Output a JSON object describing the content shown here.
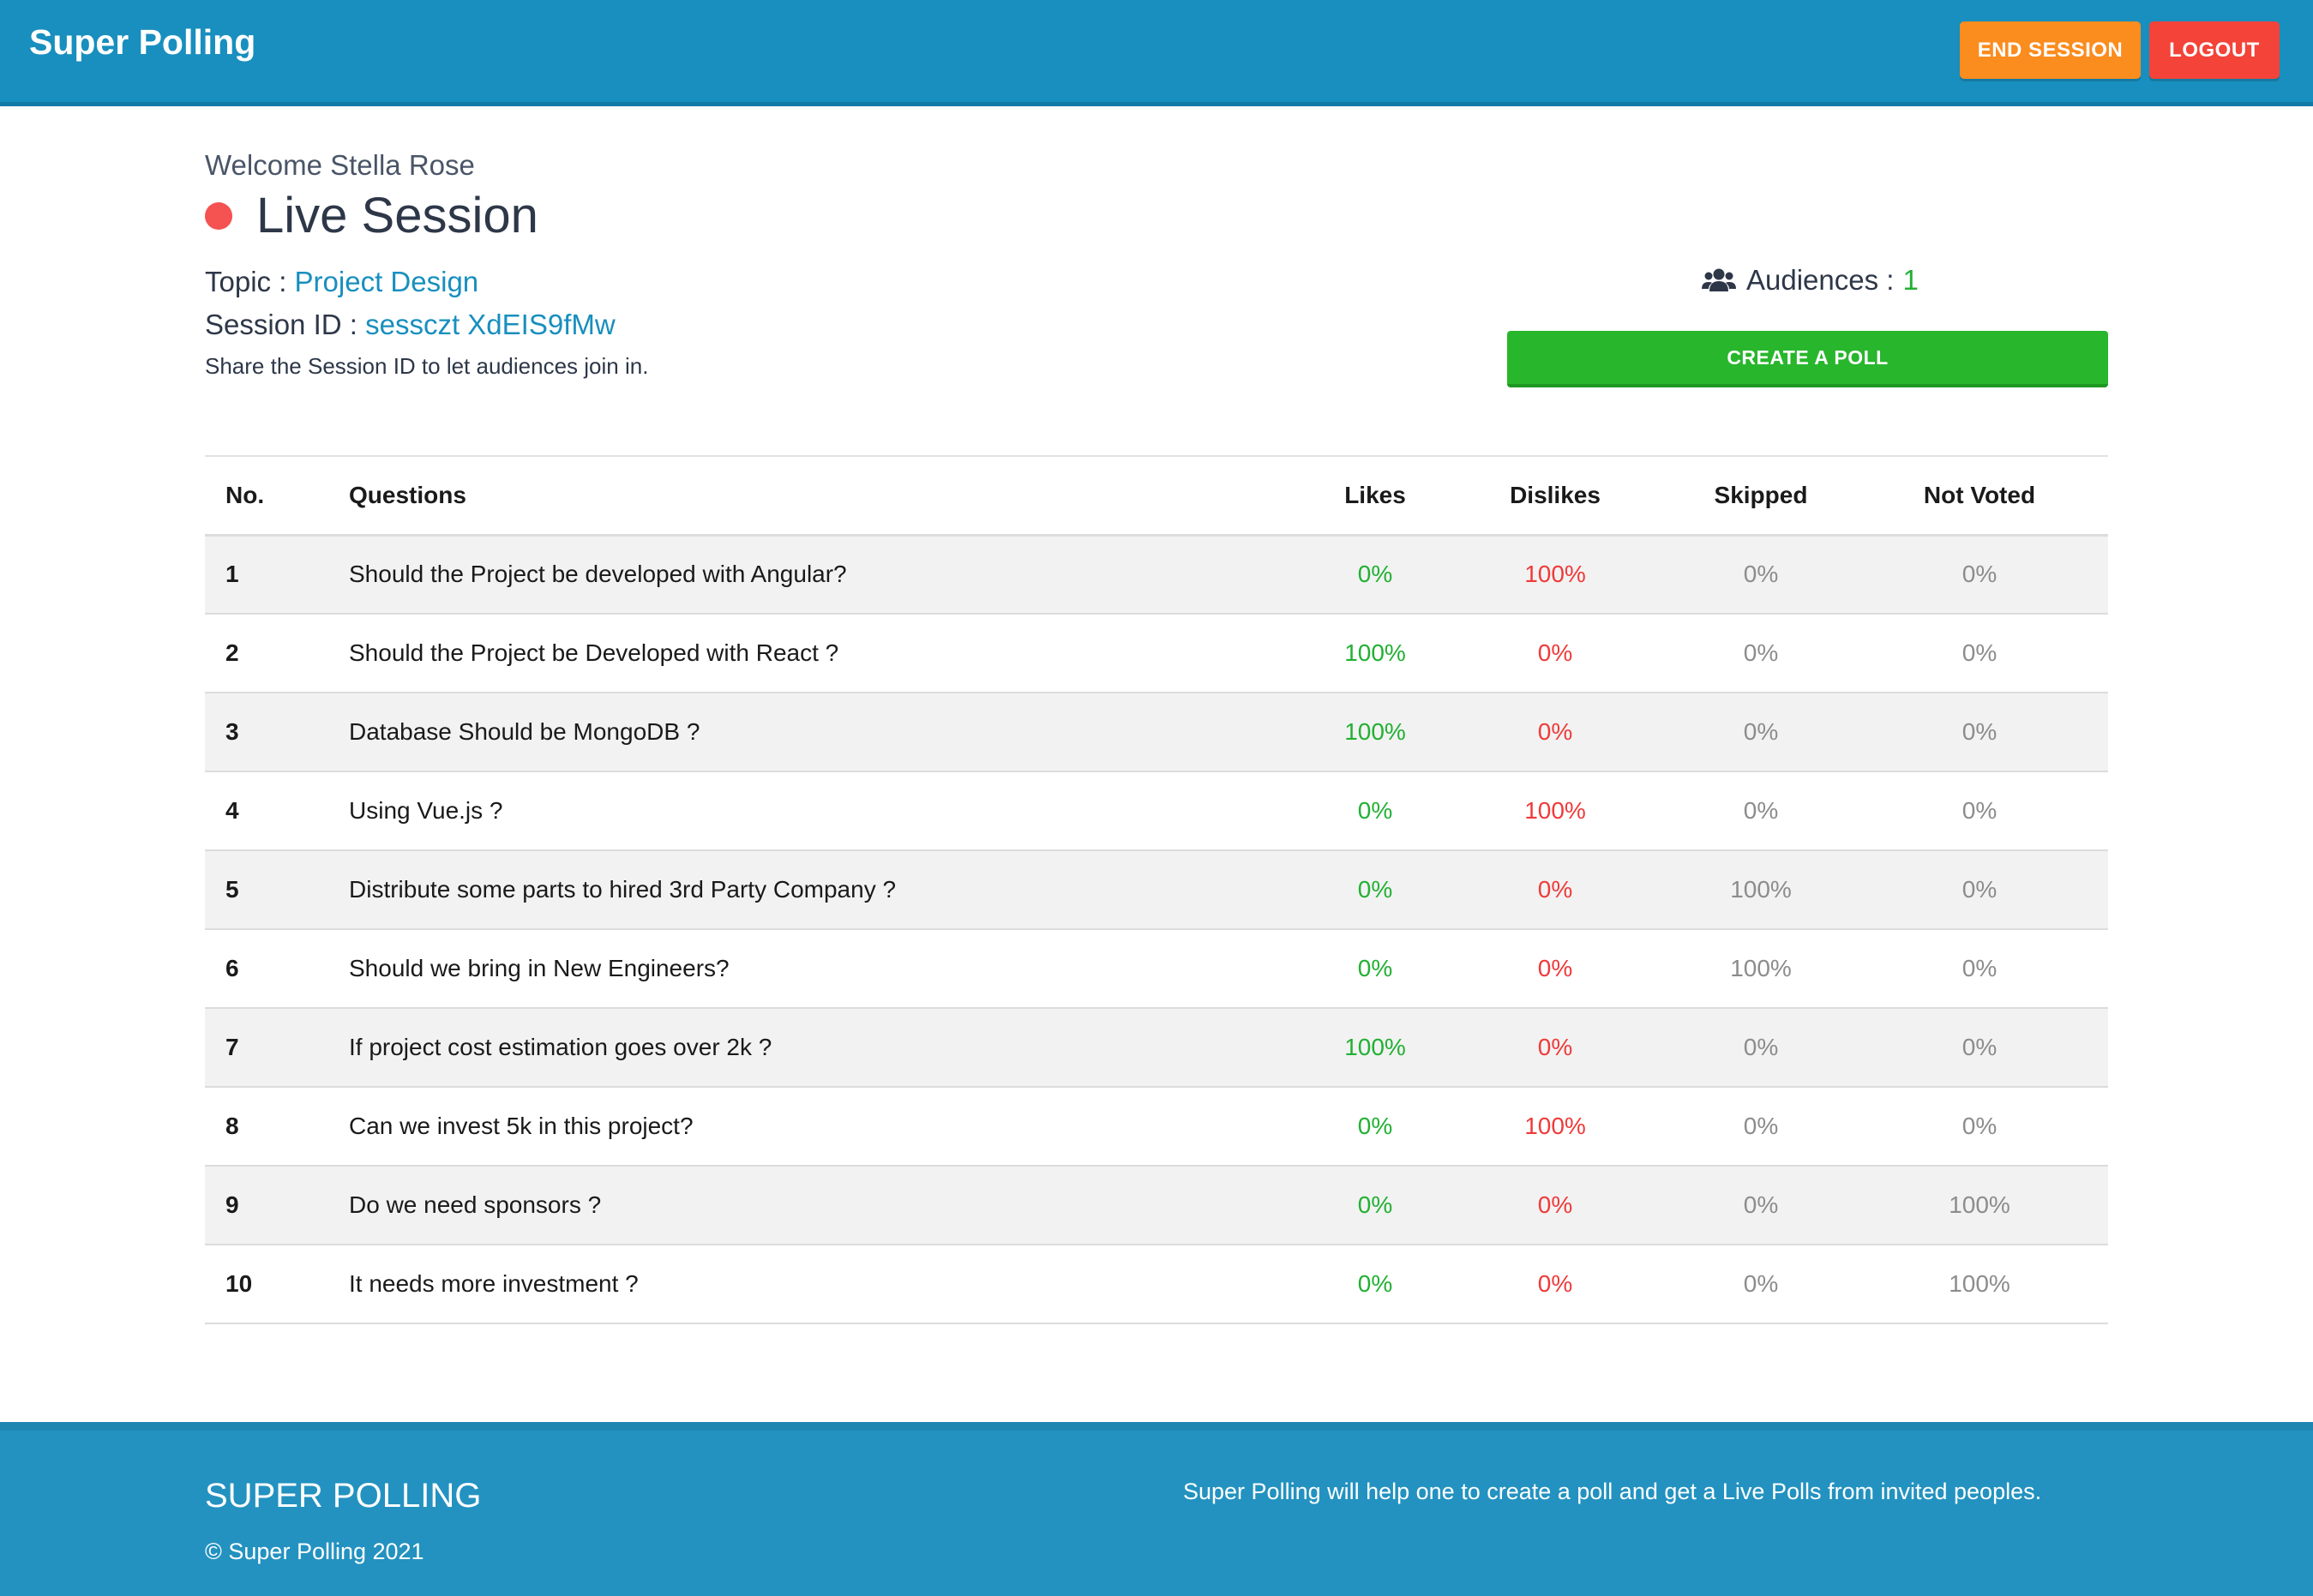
{
  "header": {
    "brand": "Super Polling",
    "end_session_label": "END SESSION",
    "logout_label": "LOGOUT",
    "color": "#188fbe"
  },
  "session": {
    "welcome": "Welcome Stella Rose",
    "status_title": "Live Session",
    "status_color": "#f55252",
    "topic_label": "Topic :",
    "topic_value": "Project Design",
    "session_id_label": "Session ID :",
    "session_id_value": "sessczt XdEIS9fMw",
    "share_hint": "Share the Session ID to let audiences join in.",
    "audiences_label": "Audiences :",
    "audiences_count": "1",
    "audiences_icon": "users-icon",
    "create_poll_label": "CREATE A POLL"
  },
  "table": {
    "headers": [
      "No.",
      "Questions",
      "Likes",
      "Dislikes",
      "Skipped",
      "Not Voted"
    ],
    "rows": [
      {
        "no": "1",
        "question": "Should the Project be developed with Angular?",
        "likes": "0%",
        "dislikes": "100%",
        "skipped": "0%",
        "not_voted": "0%"
      },
      {
        "no": "2",
        "question": "Should the Project be Developed with React ?",
        "likes": "100%",
        "dislikes": "0%",
        "skipped": "0%",
        "not_voted": "0%"
      },
      {
        "no": "3",
        "question": "Database Should be MongoDB ?",
        "likes": "100%",
        "dislikes": "0%",
        "skipped": "0%",
        "not_voted": "0%"
      },
      {
        "no": "4",
        "question": "Using Vue.js ?",
        "likes": "0%",
        "dislikes": "100%",
        "skipped": "0%",
        "not_voted": "0%"
      },
      {
        "no": "5",
        "question": "Distribute some parts to hired 3rd Party Company ?",
        "likes": "0%",
        "dislikes": "0%",
        "skipped": "100%",
        "not_voted": "0%"
      },
      {
        "no": "6",
        "question": "Should we bring in New Engineers?",
        "likes": "0%",
        "dislikes": "0%",
        "skipped": "100%",
        "not_voted": "0%"
      },
      {
        "no": "7",
        "question": "If project cost estimation goes over 2k ?",
        "likes": "100%",
        "dislikes": "0%",
        "skipped": "0%",
        "not_voted": "0%"
      },
      {
        "no": "8",
        "question": "Can we invest 5k in this project?",
        "likes": "0%",
        "dislikes": "100%",
        "skipped": "0%",
        "not_voted": "0%"
      },
      {
        "no": "9",
        "question": "Do we need sponsors ?",
        "likes": "0%",
        "dislikes": "0%",
        "skipped": "0%",
        "not_voted": "100%"
      },
      {
        "no": "10",
        "question": "It needs more investment ?",
        "likes": "0%",
        "dislikes": "0%",
        "skipped": "0%",
        "not_voted": "100%"
      }
    ]
  },
  "footer": {
    "brand": "SUPER POLLING",
    "copyright": "© Super Polling 2021",
    "description": "Super Polling will help one to create a poll and get a Live Polls from invited peoples."
  }
}
